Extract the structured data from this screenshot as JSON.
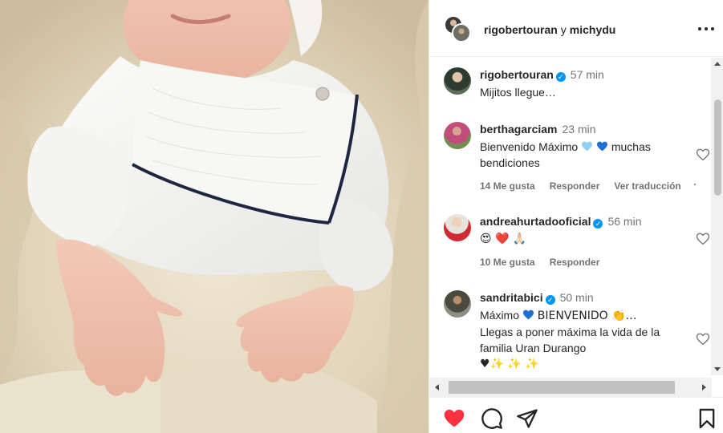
{
  "header": {
    "user1": "rigobertouran",
    "conjunction": "y",
    "user2": "michydu"
  },
  "comments": [
    {
      "username": "rigobertouran",
      "verified": true,
      "time": "57 min",
      "text": "Mijitos llegue…"
    },
    {
      "username": "berthagarciam",
      "verified": false,
      "time": "23 min",
      "text_before": "Bienvenido Máximo",
      "text_after": "muchas bendiciones",
      "likes": "14 Me gusta",
      "reply": "Responder",
      "translate": "Ver traducción"
    },
    {
      "username": "andreahurtadooficial",
      "verified": true,
      "time": "56 min",
      "text": "😍 ❤️ 🙏🏻",
      "likes": "10 Me gusta",
      "reply": "Responder"
    },
    {
      "username": "sandritabici",
      "verified": true,
      "time": "50 min",
      "text_line1_a": "Máximo",
      "text_line1_b": "BIENVENIDO 👏…",
      "text_rest": "Llegas a poner máxima la vida de la familia Uran Durango",
      "text_last": "♥✨ ✨ ✨"
    }
  ],
  "colors": {
    "like_red": "#ff3040",
    "verified_blue": "#0095f6",
    "muted_text": "#737373"
  },
  "icons": [
    "heart-filled-icon",
    "comment-icon",
    "share-icon",
    "bookmark-icon",
    "more-options-icon",
    "heart-outline-icon"
  ]
}
